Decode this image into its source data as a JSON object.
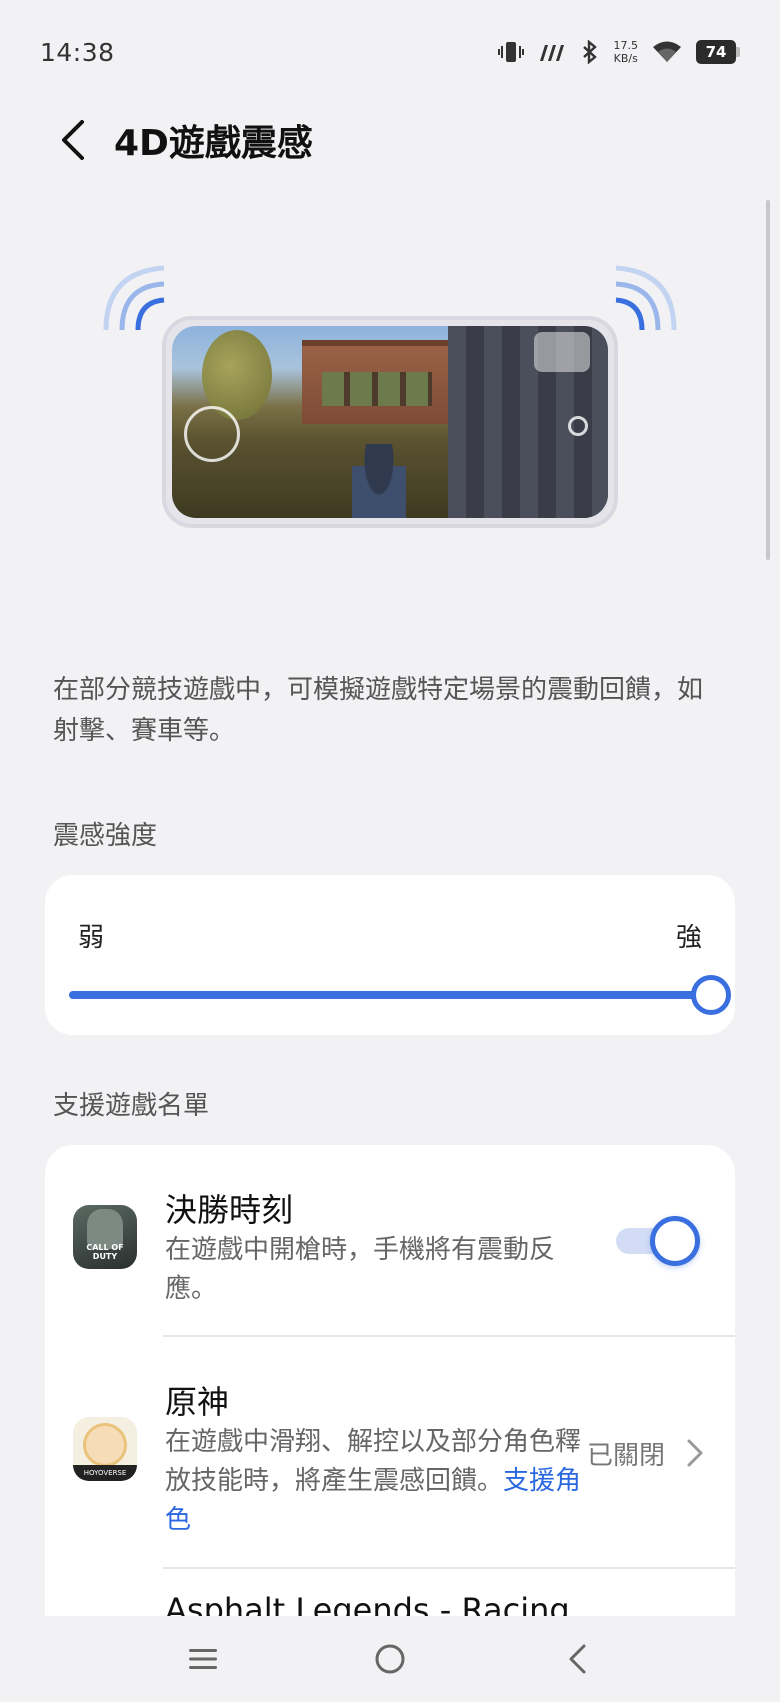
{
  "status_bar": {
    "time": "14:38",
    "net_speed_value": "17.5",
    "net_speed_unit": "KB/s",
    "battery": "74",
    "icons": [
      "vibrate-icon",
      "signal-icon",
      "bluetooth-icon",
      "wifi-icon",
      "battery-icon"
    ]
  },
  "header": {
    "title": "4D遊戲震感"
  },
  "description": "在部分競技遊戲中，可模擬遊戲特定場景的震動回饋，如射擊、賽車等。",
  "intensity": {
    "section_label": "震感強度",
    "min_label": "弱",
    "max_label": "強",
    "value": 1.0
  },
  "games": {
    "section_label": "支援遊戲名單",
    "items": [
      {
        "name": "決勝時刻",
        "desc": "在遊戲中開槍時，手機將有震動反應。",
        "enabled": true,
        "icon": "call-of-duty-app-icon",
        "icon_text": "CALL OF DUTY"
      },
      {
        "name": "原神",
        "desc": "在遊戲中滑翔、解控以及部分角色釋放技能時，將產生震感回饋。",
        "link": "支援角色",
        "status": "已關閉",
        "icon": "genshin-app-icon",
        "icon_text": "HOYOVERSE"
      },
      {
        "name": "Asphalt Legends - Racing"
      }
    ]
  },
  "colors": {
    "accent": "#3a6fdf",
    "background": "#f2f2f5",
    "card": "#ffffff"
  }
}
